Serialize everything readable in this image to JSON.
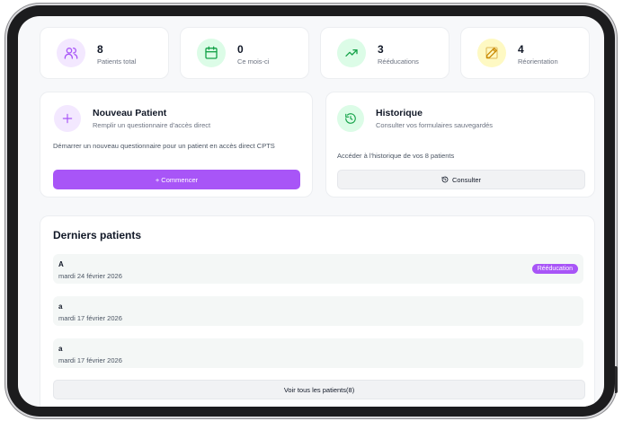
{
  "stats": [
    {
      "value": "8",
      "label": "Patients total",
      "icon": "users-icon",
      "color": "#a855f7",
      "bg": "#f3e8ff"
    },
    {
      "value": "0",
      "label": "Ce mois-ci",
      "icon": "calendar-icon",
      "color": "#16a34a",
      "bg": "#dcfce7"
    },
    {
      "value": "3",
      "label": "Rééducations",
      "icon": "trending-up-icon",
      "color": "#16a34a",
      "bg": "#dcfce7"
    },
    {
      "value": "4",
      "label": "Réorientation",
      "icon": "edit-icon",
      "color": "#ca8a04",
      "bg": "#fef9c3"
    }
  ],
  "new_patient": {
    "title": "Nouveau Patient",
    "subtitle": "Remplir un questionnaire d'accès direct",
    "description": "Démarrer un nouveau questionnaire pour un patient en accès direct CPTS",
    "button": "+ Commencer"
  },
  "history": {
    "title": "Historique",
    "subtitle": "Consulter vos formulaires sauvegardés",
    "description": "Accéder à l'historique de vos 8 patients",
    "button": "Consulter"
  },
  "recent": {
    "title": "Derniers patients",
    "patients": [
      {
        "name": "A",
        "date": "mardi 24 février 2026",
        "badge": "Rééducation"
      },
      {
        "name": "a",
        "date": "mardi 17 février 2026",
        "badge": ""
      },
      {
        "name": "a",
        "date": "mardi 17 février 2026",
        "badge": ""
      }
    ],
    "view_all": "Voir tous les patients(8)"
  },
  "colors": {
    "accent": "#a855f7",
    "green": "#16a34a"
  }
}
